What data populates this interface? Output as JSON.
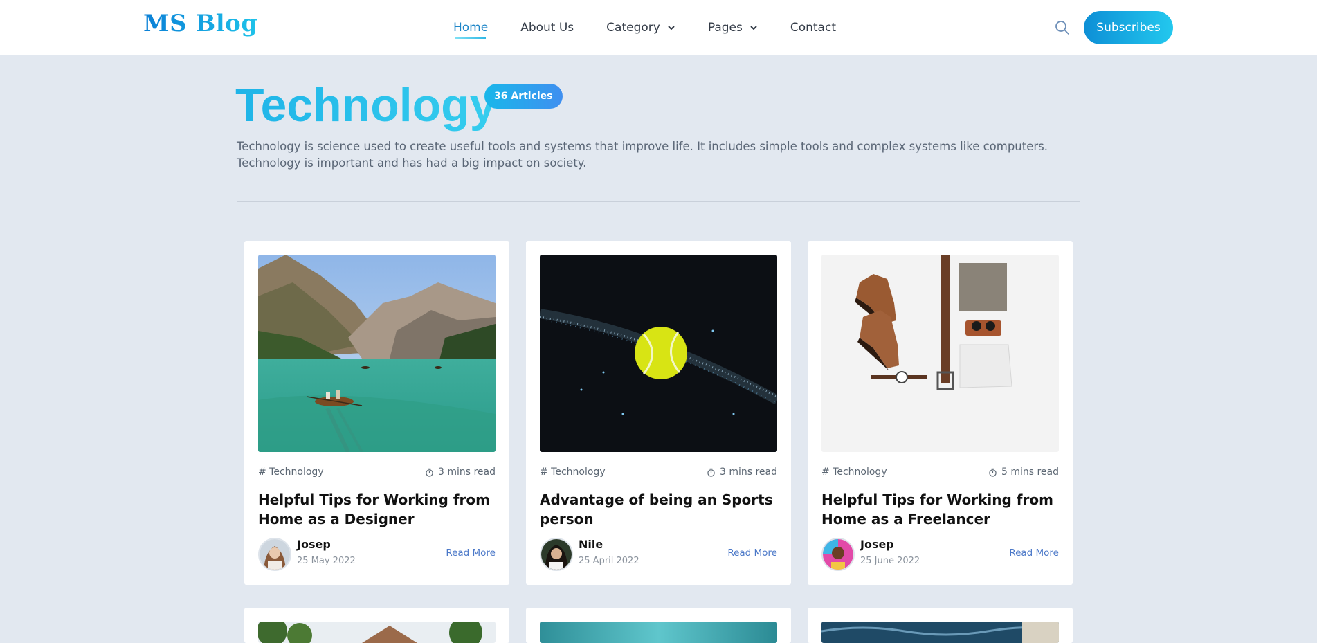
{
  "header": {
    "logo": "MS Blog",
    "nav": [
      {
        "label": "Home",
        "active": true,
        "dropdown": false
      },
      {
        "label": "About Us",
        "active": false,
        "dropdown": false
      },
      {
        "label": "Category",
        "active": false,
        "dropdown": true
      },
      {
        "label": "Pages",
        "active": false,
        "dropdown": true
      },
      {
        "label": "Contact",
        "active": false,
        "dropdown": false
      }
    ],
    "subscribe_label": "Subscribes",
    "search_icon": "search-icon"
  },
  "hero": {
    "title": "Technology",
    "badge": "36 Articles",
    "description": "Technology is science used to create useful tools and systems that improve life. It includes simple tools and complex systems like computers. Technology is important and has had a big impact on society."
  },
  "posts": [
    {
      "category": "# Technology",
      "read_time": "3 mins read",
      "title": "Helpful Tips for Working from Home as a Designer",
      "author": "Josep",
      "date": "25 May 2022",
      "read_more": "Read More",
      "image": "mountain-lake-boat"
    },
    {
      "category": "# Technology",
      "read_time": "3 mins read",
      "title": "Advantage of being an Sports person",
      "author": "Nile",
      "date": "25 April 2022",
      "read_more": "Read More",
      "image": "tennis-ball-galaxy"
    },
    {
      "category": "# Technology",
      "read_time": "5 mins read",
      "title": "Helpful Tips for Working from Home as a Freelancer",
      "author": "Josep",
      "date": "25 June 2022",
      "read_more": "Read More",
      "image": "boots-belt-flatlay"
    }
  ],
  "colors": {
    "background": "#e2e8f0",
    "accent_blue": "#1e86c8",
    "accent_cyan": "#23c8ee",
    "link": "#4b78c8"
  }
}
